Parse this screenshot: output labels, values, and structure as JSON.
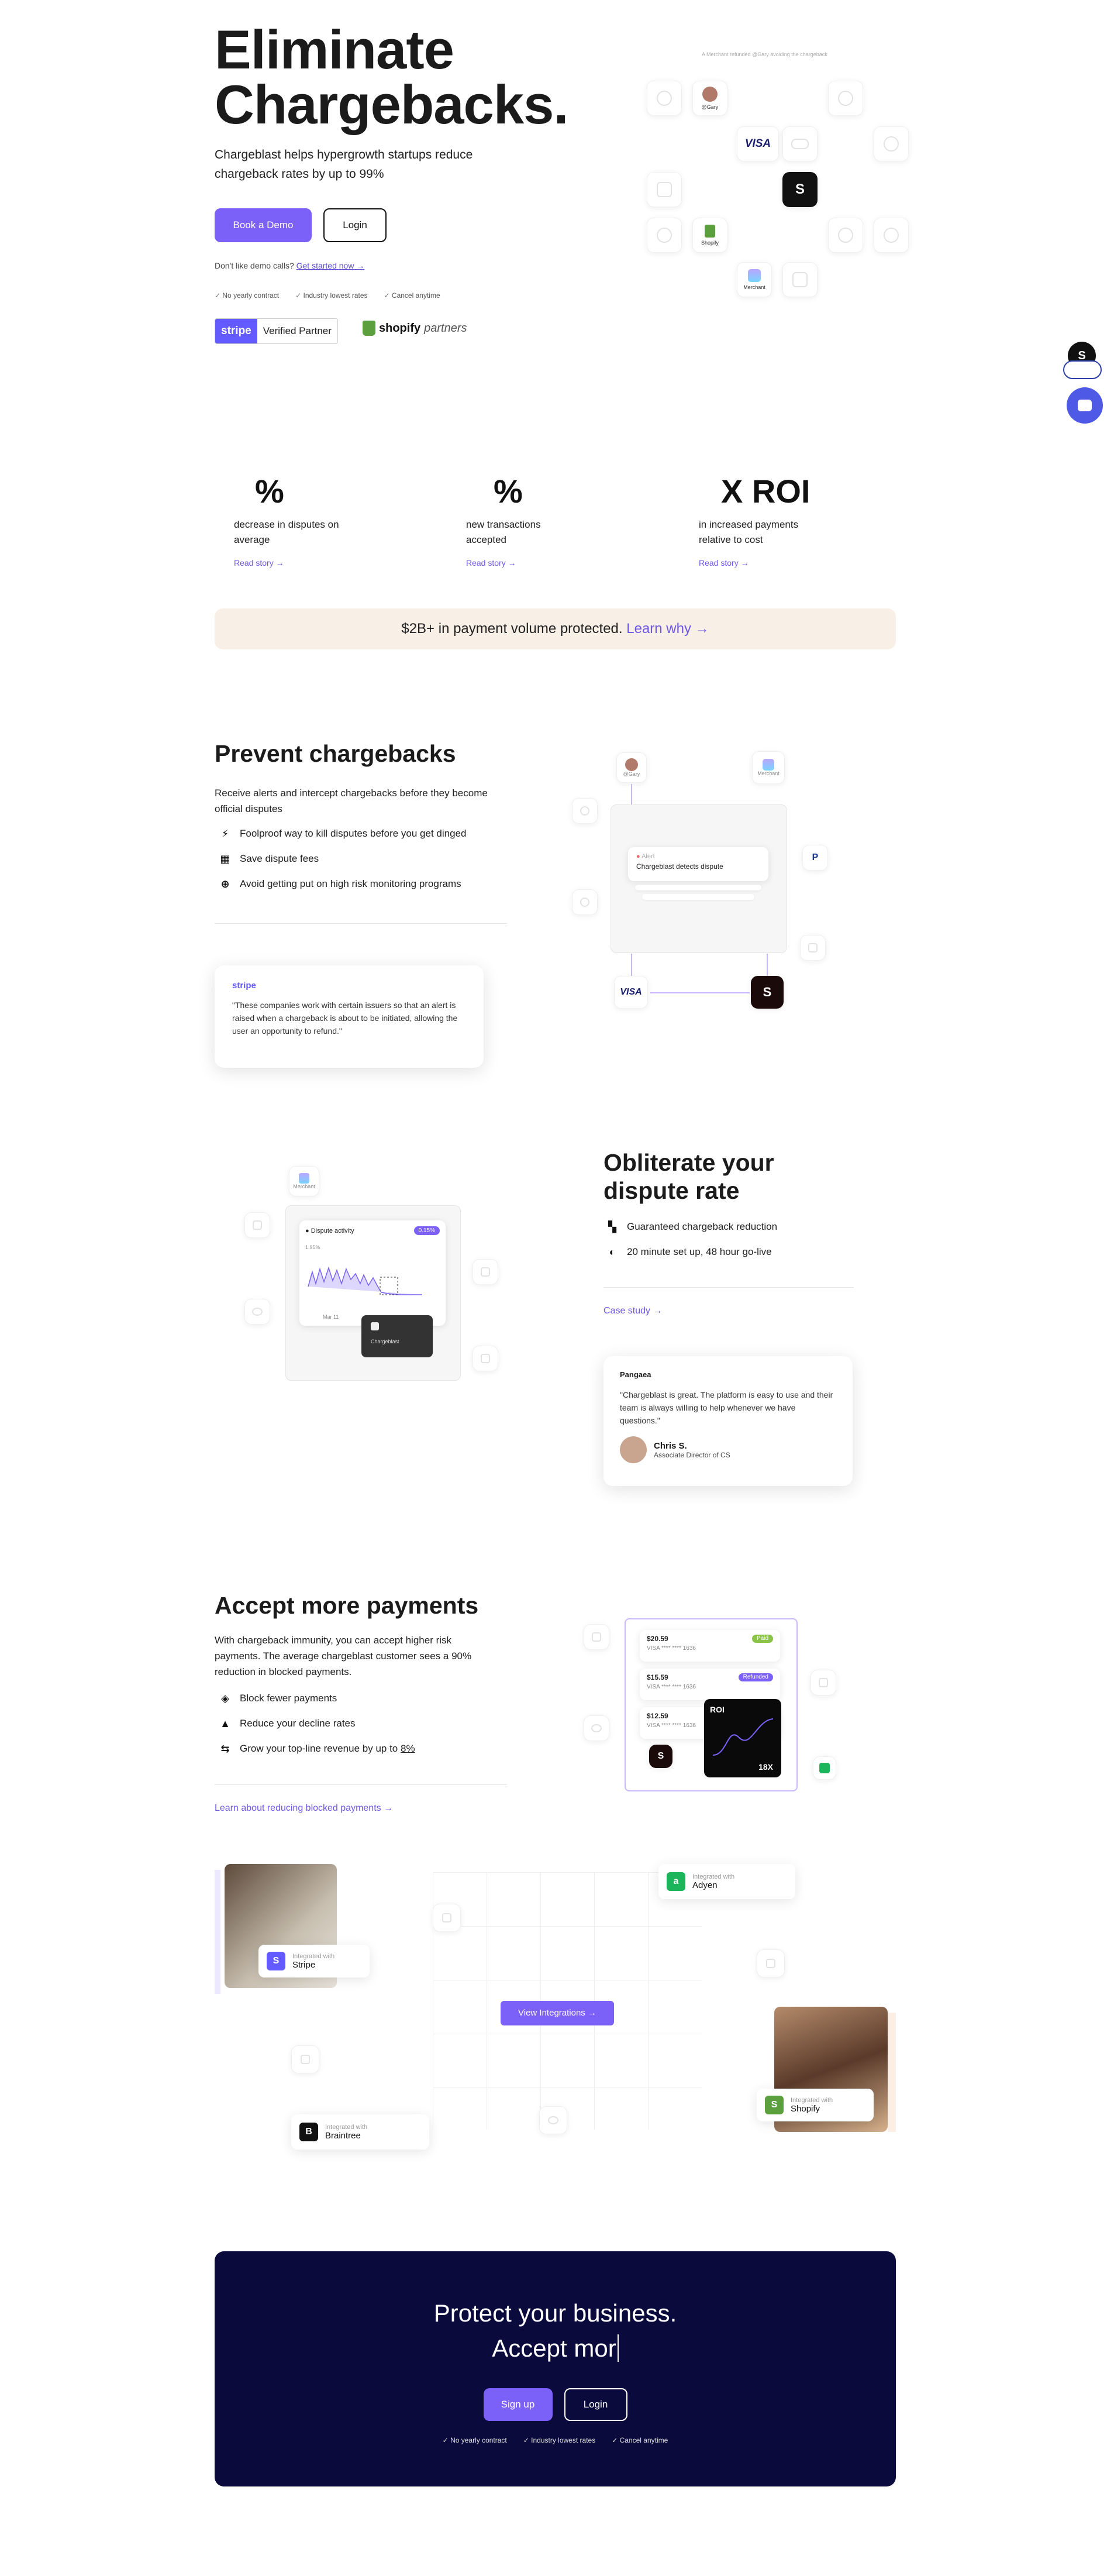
{
  "hero": {
    "title": "Eliminate Chargebacks.",
    "subtitle": "Chargeblast helps hypergrowth startups reduce chargeback rates by up to 99%",
    "book_demo": "Book a Demo",
    "login": "Login",
    "no_demo_text": "Don't like demo calls?",
    "get_started": "Get started now →",
    "checks": [
      "No yearly contract",
      "Industry lowest rates",
      "Cancel anytime"
    ],
    "stripe_badge": "stripe",
    "stripe_verified": "Verified Partner",
    "shopify_name": "shopify",
    "shopify_partners": "partners",
    "floating_caption": "A Merchant refunded @Gary avoiding the chargeback",
    "logos": {
      "visa": "VISA",
      "user": "@Gary",
      "shopify": "Shopify",
      "merchant": "Merchant"
    }
  },
  "stats": [
    {
      "num": "%",
      "label": "decrease in disputes on average",
      "link": "Read story →"
    },
    {
      "num": "%",
      "label": "new transactions accepted",
      "link": "Read story →"
    },
    {
      "num": "X ROI",
      "label": "in increased payments relative to cost",
      "link": "Read story →"
    }
  ],
  "banner": {
    "text": "$2B+ in payment volume protected.",
    "link": "Learn why →"
  },
  "prevent": {
    "title": "Prevent chargebacks",
    "desc": "Receive alerts and intercept chargebacks before they become official disputes",
    "features": [
      "Foolproof way to kill disputes before you get dinged",
      "Save dispute fees",
      "Avoid getting put on high risk monitoring programs"
    ],
    "quote_brand": "stripe",
    "quote": "\"These companies work with certain issuers so that an alert is raised when a chargeback is about to be initiated, allowing the user an opportunity to refund.\"",
    "alert_title": "Alert",
    "alert_text": "Chargeblast detects dispute",
    "user_label": "@Gary",
    "merchant_label": "Merchant",
    "visa": "VISA"
  },
  "obliterate": {
    "title": "Obliterate your dispute rate",
    "features": [
      "Guaranteed chargeback reduction",
      "20 minute set up, 48 hour go-live"
    ],
    "case_study": "Case study →",
    "quote_brand": "Pangaea",
    "quote": "\"Chargeblast is great. The platform is easy to use and their team is always willing to help whenever we have questions.\"",
    "person_name": "Chris S.",
    "person_role": "Associate Director of CS",
    "chart_title": "Dispute activity",
    "chart_badge": "0.15%",
    "chart_small": "1.95%",
    "chart_date": "Mar 11",
    "merchant_label": "Merchant",
    "tooltip": "Chargeblast"
  },
  "accept": {
    "title": "Accept more payments",
    "desc": "With chargeback immunity, you can accept higher risk payments. The average chargeblast customer sees a 90% reduction in blocked payments.",
    "features": [
      "Block fewer payments",
      "Reduce your decline rates",
      "Grow your top-line revenue by up to"
    ],
    "feature_pct": "8%",
    "link": "Learn about reducing blocked payments →",
    "tx": [
      {
        "amt": "$20.59",
        "card": "VISA **** **** 1636",
        "tag": "Paid"
      },
      {
        "amt": "$15.59",
        "card": "VISA **** **** 1636",
        "tag": "Refunded"
      },
      {
        "amt": "$12.59",
        "card": "VISA **** **** 1636",
        "tag": ""
      }
    ],
    "roi_label": "ROI",
    "roi_value": "18X"
  },
  "integrations": {
    "button": "View Integrations →",
    "items": [
      {
        "caption": "Integrated with",
        "name": "Stripe"
      },
      {
        "caption": "Integrated with",
        "name": "Adyen"
      },
      {
        "caption": "Integrated with",
        "name": "Braintree"
      },
      {
        "caption": "Integrated with",
        "name": "Shopify"
      }
    ]
  },
  "cta": {
    "line1": "Protect your business.",
    "line2": "Accept mor",
    "signup": "Sign up",
    "login": "Login",
    "checks": [
      "No yearly contract",
      "Industry lowest rates",
      "Cancel anytime"
    ]
  },
  "colors": {
    "accent": "#7b61f8",
    "navy": "#0b0a3d",
    "banner": "#f8efe6"
  }
}
